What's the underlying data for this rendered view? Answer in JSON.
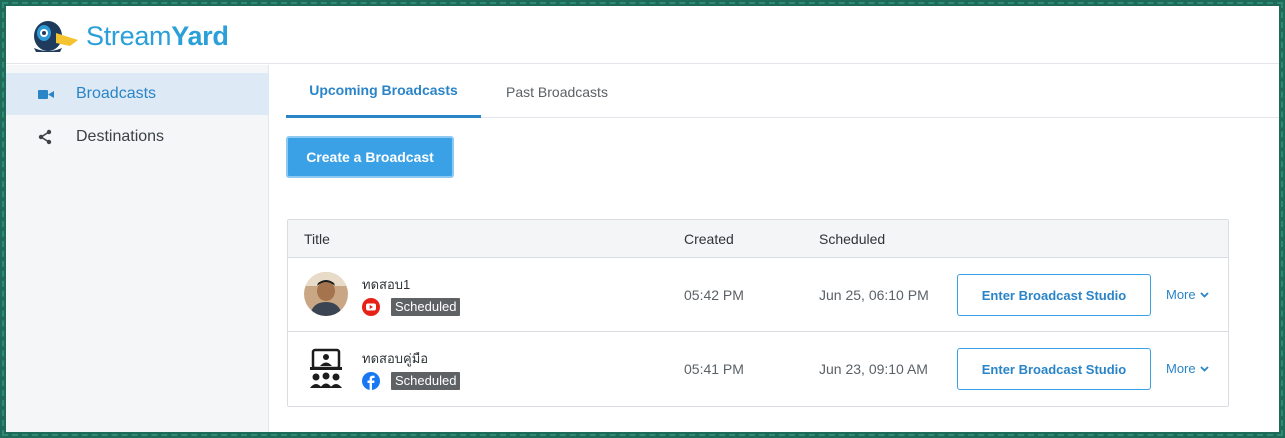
{
  "app": {
    "logo_text_light": "Stream",
    "logo_text_bold": "Yard"
  },
  "sidebar": {
    "items": [
      {
        "label": "Broadcasts",
        "icon": "video-camera-icon",
        "active": true
      },
      {
        "label": "Destinations",
        "icon": "share-icon",
        "active": false
      }
    ]
  },
  "tabs": [
    {
      "label": "Upcoming Broadcasts",
      "active": true
    },
    {
      "label": "Past Broadcasts",
      "active": false
    }
  ],
  "create_button": "Create a Broadcast",
  "table": {
    "headers": {
      "title": "Title",
      "created": "Created",
      "scheduled": "Scheduled"
    },
    "rows": [
      {
        "title": "ทดสอบ1",
        "platform": "youtube-icon",
        "status": "Scheduled",
        "created": "05:42 PM",
        "scheduled": "Jun 25, 06:10 PM",
        "action": "Enter Broadcast Studio",
        "more": "More"
      },
      {
        "title": "ทดสอบคู่มือ",
        "platform": "facebook-icon",
        "status": "Scheduled",
        "created": "05:41 PM",
        "scheduled": "Jun 23, 09:10 AM",
        "action": "Enter Broadcast Studio",
        "more": "More"
      }
    ]
  },
  "colors": {
    "accent": "#2a84c8",
    "button": "#3aa1e6",
    "youtube": "#e62117",
    "facebook": "#1877f2"
  }
}
